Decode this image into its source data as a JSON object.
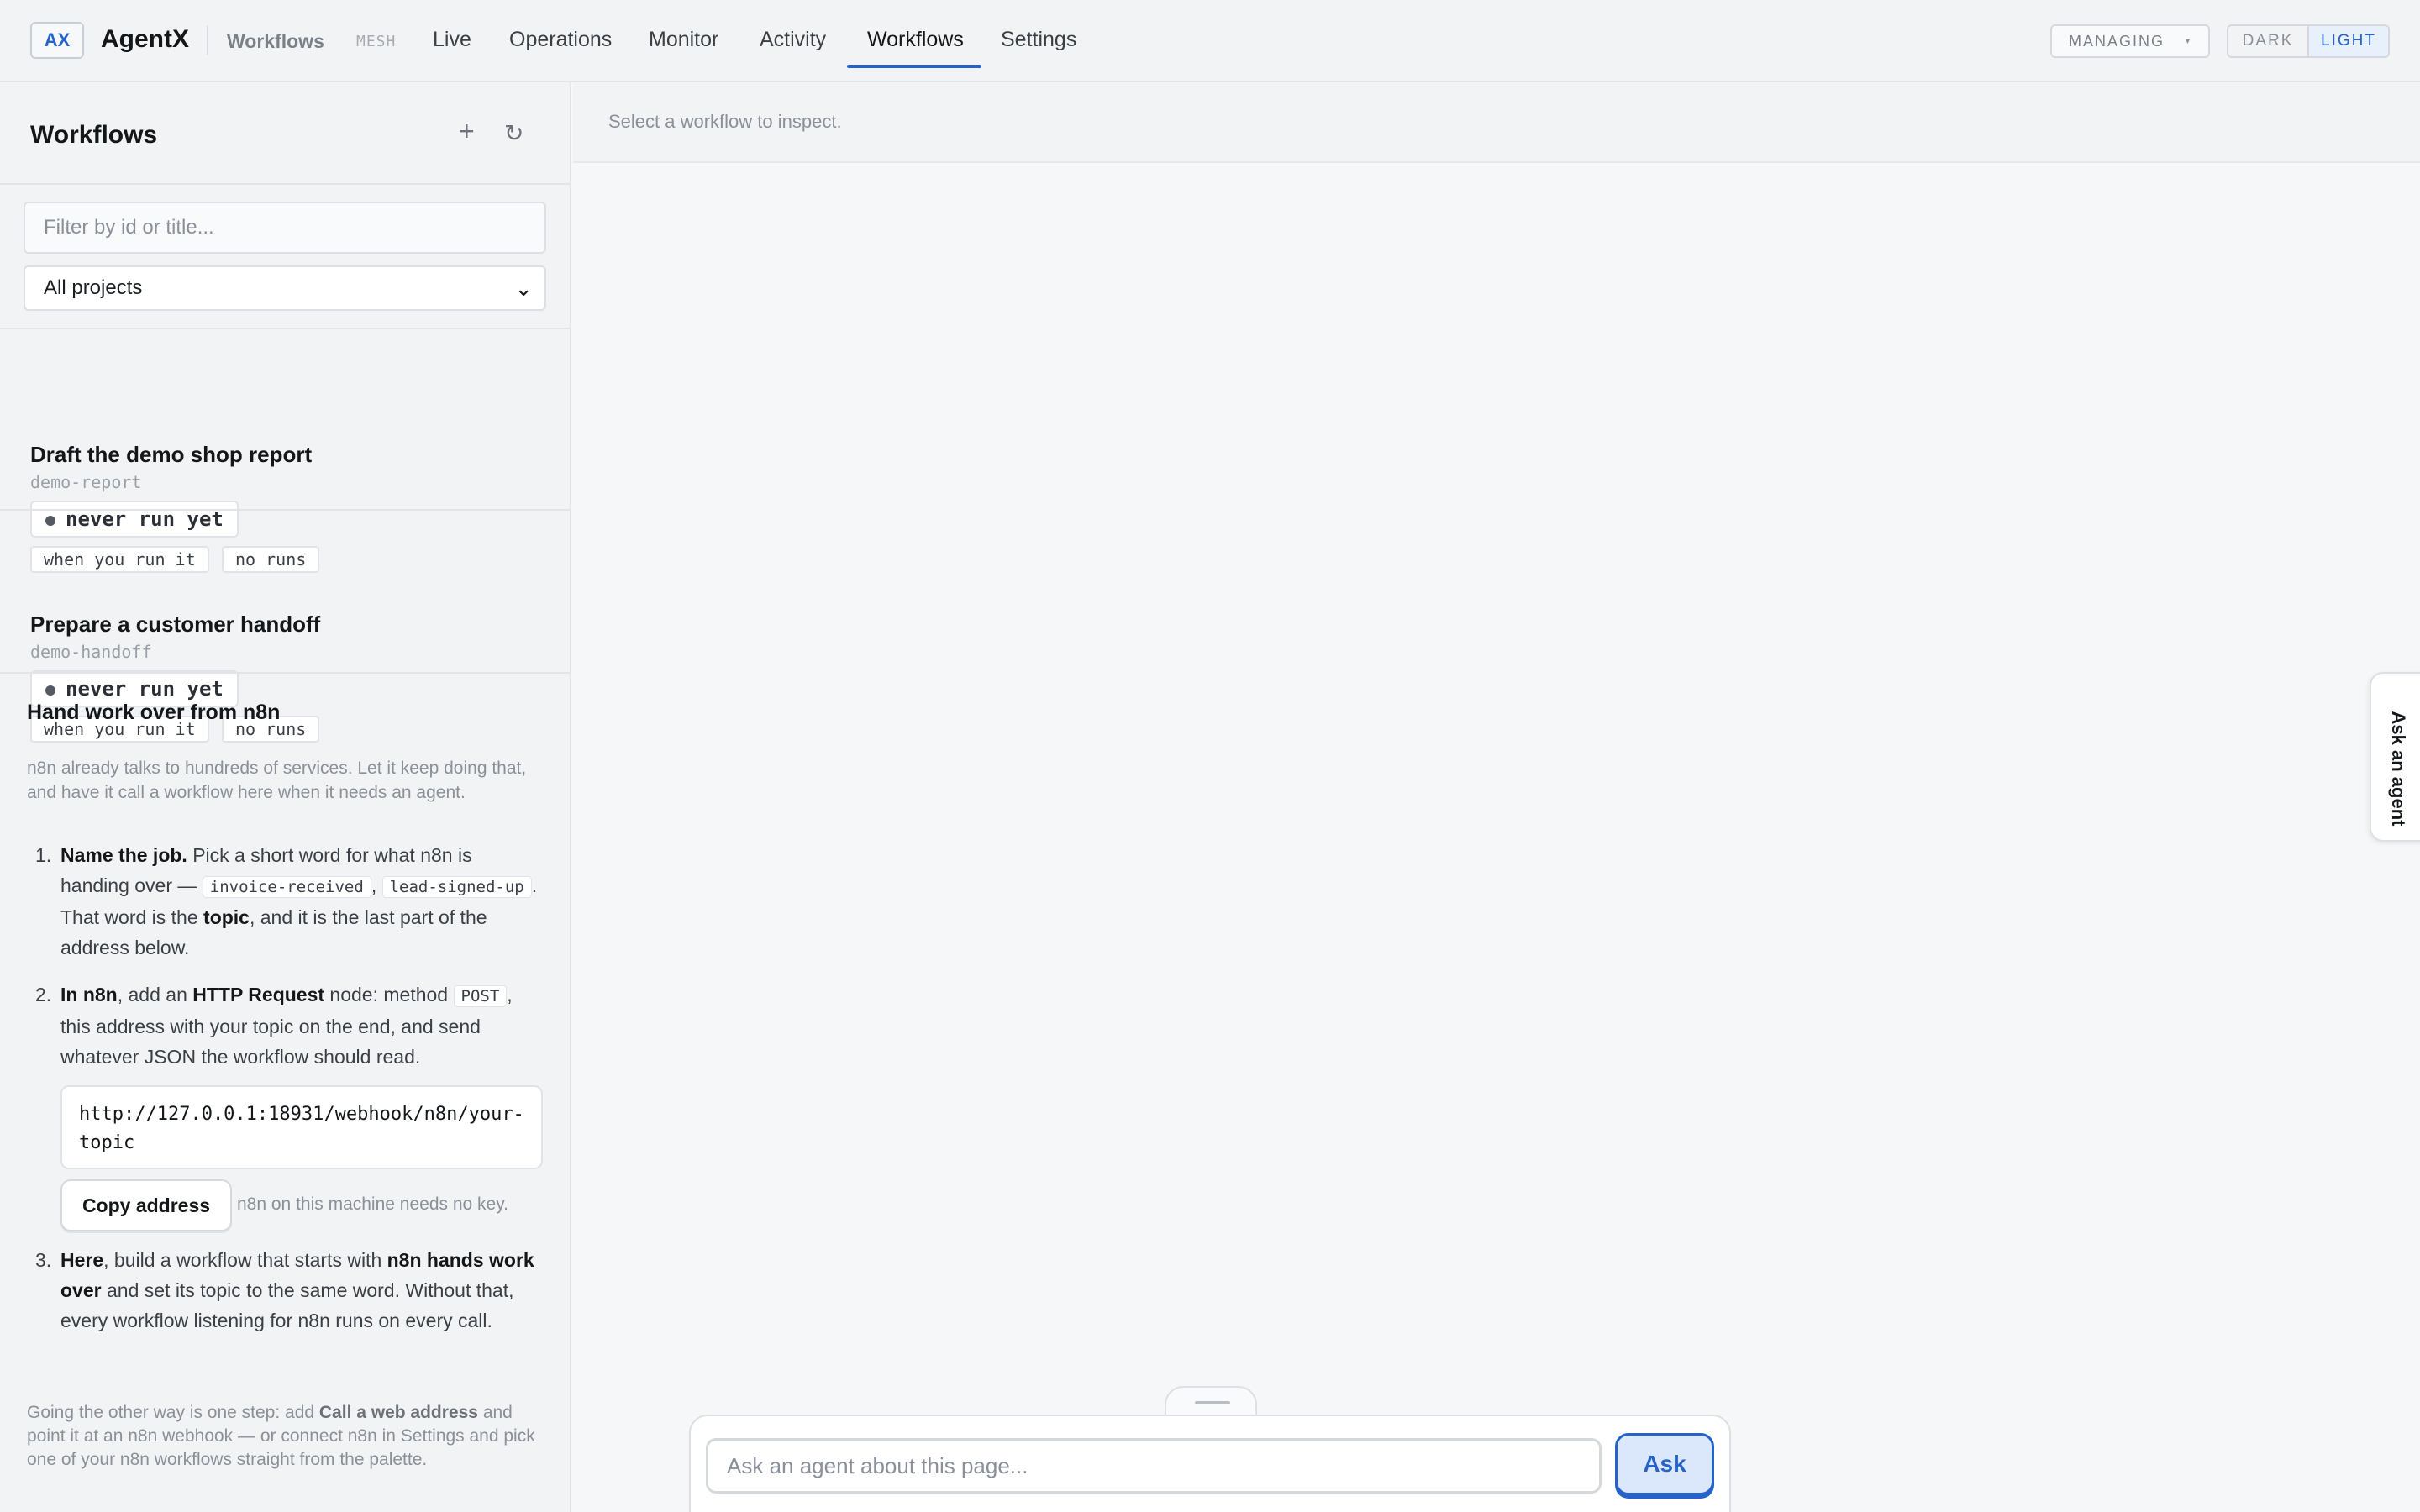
{
  "app": {
    "logo_text": "AX",
    "name": "AgentX",
    "sub_link": "Workflows",
    "mesh_label": "MESH"
  },
  "nav": {
    "items": [
      {
        "label": "Live"
      },
      {
        "label": "Operations"
      },
      {
        "label": "Monitor"
      },
      {
        "label": "Activity"
      },
      {
        "label": "Workflows",
        "active": true
      },
      {
        "label": "Settings"
      }
    ]
  },
  "controls": {
    "managing_label": "MANAGING",
    "managing_caret": "▾",
    "theme_dark": "DARK",
    "theme_light": "LIGHT",
    "active_theme": "LIGHT"
  },
  "sidebar": {
    "title": "Workflows",
    "add_glyph": "+",
    "refresh_glyph": "↻",
    "filter_placeholder": "Filter by id or title...",
    "project_select": {
      "selected": "All projects",
      "chevron": "⌄"
    },
    "workflows": [
      {
        "title": "Draft the demo shop report",
        "id": "demo-report",
        "status": "never run yet",
        "trigger": "when you run it",
        "runs": "no runs"
      },
      {
        "title": "Prepare a customer handoff",
        "id": "demo-handoff",
        "status": "never run yet",
        "trigger": "when you run it",
        "runs": "no runs"
      }
    ],
    "n8n": {
      "title": "Hand work over from n8n",
      "intro": "n8n already talks to hundreds of services. Let it keep doing that, and have it call a workflow here when it needs an agent.",
      "step1": {
        "num": "1.",
        "lead": "Name the job.",
        "t1": " Pick a short word for what n8n is handing over — ",
        "code1": "invoice-received",
        "t2": ", ",
        "code2": "lead-signed-up",
        "t3": ". That word is the ",
        "bold": "topic",
        "t4": ", and it is the last part of the address below."
      },
      "step2": {
        "num": "2.",
        "lead": "In n8n",
        "t1": ", add an ",
        "bold": "HTTP Request",
        "t2": " node: method ",
        "code": "POST",
        "t3": ", this address with your topic on the end, and send whatever JSON the workflow should read."
      },
      "url": "http://127.0.0.1:18931/webhook/n8n/your-topic",
      "copy_button": "Copy address",
      "copy_note": "n8n on this machine needs no key.",
      "step3": {
        "num": "3.",
        "lead": "Here",
        "t1": ", build a workflow that starts with ",
        "bold": "n8n hands work over",
        "t2": " and set its topic to the same word. Without that, every workflow listening for n8n runs on every call."
      },
      "footer": {
        "t1": "Going the other way is one step: add ",
        "bold": "Call a web address",
        "t2": " and point it at an n8n webhook — or connect n8n in Settings and pick one of your n8n workflows straight from the palette."
      }
    }
  },
  "main": {
    "hint": "Select a workflow to inspect."
  },
  "ask": {
    "tab_label": "Ask an agent",
    "placeholder": "Ask an agent about this page...",
    "button": "Ask"
  },
  "colors": {
    "accent": "#2563c9",
    "background": "#f6f7f8",
    "panel": "#f2f3f4",
    "border": "#e2e4e7",
    "muted_text": "#8a9099"
  }
}
